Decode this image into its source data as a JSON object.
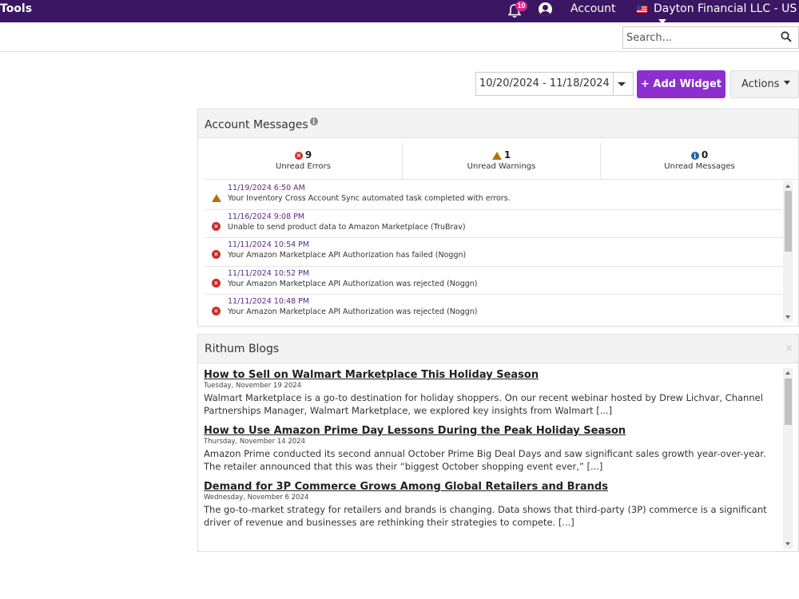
{
  "topbar": {
    "tools_label": "Tools",
    "notification_count": "10",
    "account_label": "Account",
    "company_label": "Dayton Financial LLC - US"
  },
  "search": {
    "placeholder": "Search..."
  },
  "toolbar": {
    "date_range": "10/20/2024 - 11/18/2024",
    "add_widget_label": "+ Add Widget",
    "actions_label": "Actions"
  },
  "account_messages": {
    "title": "Account Messages",
    "errors": {
      "count": "9",
      "label": "Unread Errors"
    },
    "warnings": {
      "count": "1",
      "label": "Unread Warnings"
    },
    "messages": {
      "count": "0",
      "label": "Unread Messages"
    },
    "items": [
      {
        "type": "warning",
        "timestamp": "11/19/2024 6:50 AM",
        "text": "Your Inventory Cross Account Sync automated task completed with errors."
      },
      {
        "type": "error",
        "timestamp": "11/16/2024 9:08 PM",
        "text": "Unable to send product data to Amazon Marketplace (TruBrav)"
      },
      {
        "type": "error",
        "timestamp": "11/11/2024 10:54 PM",
        "text": "Your Amazon Marketplace API Authorization has failed (Noggn)"
      },
      {
        "type": "error",
        "timestamp": "11/11/2024 10:52 PM",
        "text": "Your Amazon Marketplace API Authorization was rejected (Noggn)"
      },
      {
        "type": "error",
        "timestamp": "11/11/2024 10:48 PM",
        "text": "Your Amazon Marketplace API Authorization was rejected (Noggn)"
      }
    ]
  },
  "blogs": {
    "title": "Rithum Blogs",
    "close_label": "×",
    "posts": [
      {
        "title": "How to Sell on Walmart Marketplace This Holiday Season",
        "date": "Tuesday, November 19 2024",
        "excerpt": "Walmart Marketplace is a go-to destination for holiday shoppers. On our recent webinar hosted by Drew Lichvar, Channel Partnerships Manager, Walmart Marketplace, we explored key insights from Walmart [...]"
      },
      {
        "title": "How to Use Amazon Prime Day Lessons During the Peak Holiday Season",
        "date": "Thursday, November 14 2024",
        "excerpt": "Amazon Prime conducted its second annual October Prime Big Deal Days and saw significant sales growth year-over-year. The retailer announced that this was their “biggest October shopping event ever,” [...]"
      },
      {
        "title": "Demand for 3P Commerce Grows Among Global Retailers and Brands",
        "date": "Wednesday, November 6 2024",
        "excerpt": "The go-to-market strategy for retailers and brands is changing. Data shows that third-party (3P) commerce is a significant driver of revenue and businesses are rethinking their strategies to compete. [...]"
      }
    ]
  },
  "colors": {
    "topbar_bg": "#3b1662",
    "accent_purple": "#8d2fd0",
    "error_red": "#c9302c",
    "warning_amber": "#b27400",
    "info_blue": "#1f5fa8",
    "badge_pink": "#e0218a"
  },
  "icons": {
    "notification": "bell-icon",
    "account": "user-circle-icon",
    "flag": "us-flag-icon",
    "search": "search-icon",
    "error": "error-circle-icon",
    "warning": "warning-triangle-icon",
    "info": "info-circle-icon"
  }
}
